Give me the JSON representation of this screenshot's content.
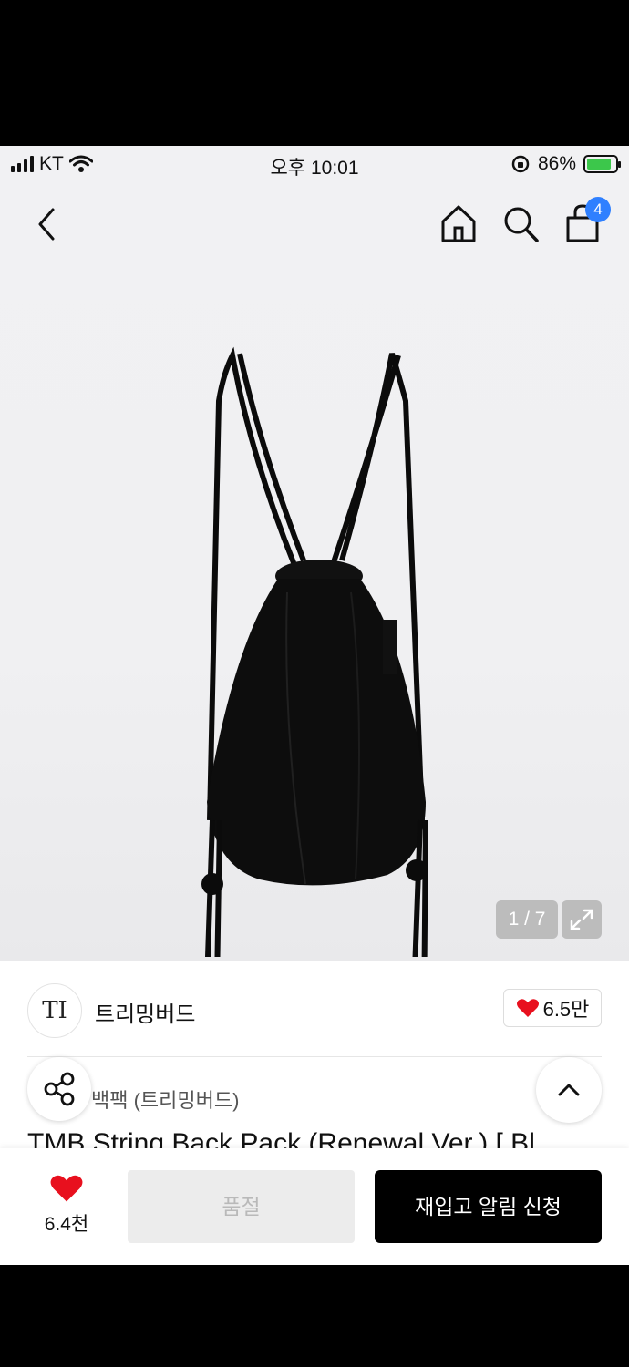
{
  "status_bar": {
    "carrier": "KT",
    "time": "오후 10:01",
    "battery": "86%",
    "battery_level": 0.86
  },
  "nav": {
    "cart_count": "4"
  },
  "gallery": {
    "pager": "1 / 7"
  },
  "brand": {
    "logo_letters": "TI",
    "name": "트리밍버드",
    "like_count": "6.5만"
  },
  "product": {
    "category": "백팩 (트리밍버드)",
    "title": "TMB String Back Pack (Renewal Ver.) [ Bl"
  },
  "bottom_bar": {
    "wish_count": "6.4천",
    "soldout_label": "품절",
    "restock_label": "재입고 알림 신청"
  },
  "colors": {
    "accent_badge": "#2f80ff",
    "heart": "#e8101e",
    "primary_button": "#000000",
    "battery_fill": "#3cc74b"
  }
}
